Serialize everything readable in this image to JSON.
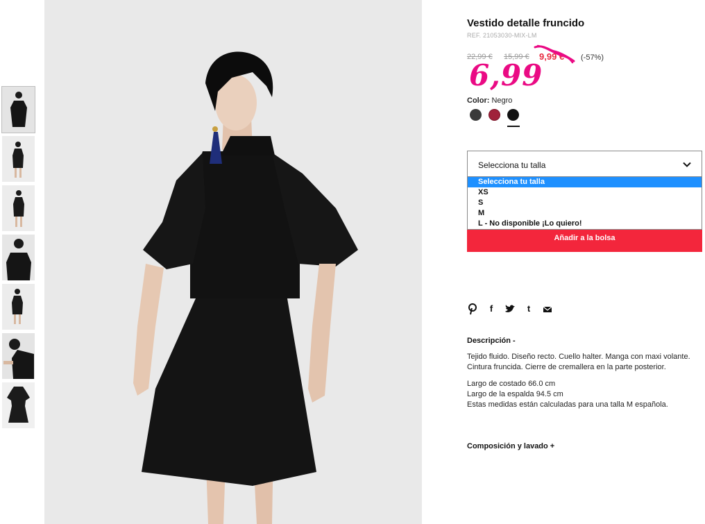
{
  "product": {
    "title": "Vestido detalle fruncido",
    "ref": "REF. 21053030-MIX-LM",
    "old_price_1": "22,99 €",
    "old_price_2": "15,99 €",
    "sale_price": "9,99 €",
    "discount": "(-57%)",
    "new_price_handwritten": "6,99",
    "color_label": "Color:",
    "color_value": "Negro",
    "swatches": [
      {
        "name": "gris oscuro",
        "color": "#3a3a3a"
      },
      {
        "name": "burdeos",
        "color": "#a0223a"
      },
      {
        "name": "negro",
        "color": "#111111",
        "selected": true
      }
    ]
  },
  "size_select": {
    "label": "Selecciona tu talla",
    "options": [
      {
        "label": "Selecciona tu talla",
        "highlighted": true
      },
      {
        "label": "XS"
      },
      {
        "label": "S"
      },
      {
        "label": "M"
      },
      {
        "label": "L - No disponible ¡Lo quiero!"
      }
    ]
  },
  "add_to_bag": "Añadir a la bolsa",
  "share": {
    "icons": [
      "pinterest-icon",
      "facebook-icon",
      "twitter-icon",
      "tumblr-icon",
      "email-icon"
    ],
    "facebook_glyph": "f",
    "tumblr_glyph": "t"
  },
  "description": {
    "heading": "Descripción -",
    "text": "Tejido fluido. Diseño recto. Cuello halter. Manga con maxi volante. Cintura fruncida. Cierre de cremallera en la parte posterior.",
    "measure_1": "Largo de costado 66.0 cm",
    "measure_2": "Largo de la espalda 94.5 cm",
    "measure_note": "Estas medidas están calculadas para una talla M española."
  },
  "composition_heading": "Composición y lavado +",
  "colors": {
    "accent_red": "#f3263c",
    "highlight_pink": "#ea0a84",
    "option_highlight": "#1e90ff"
  }
}
